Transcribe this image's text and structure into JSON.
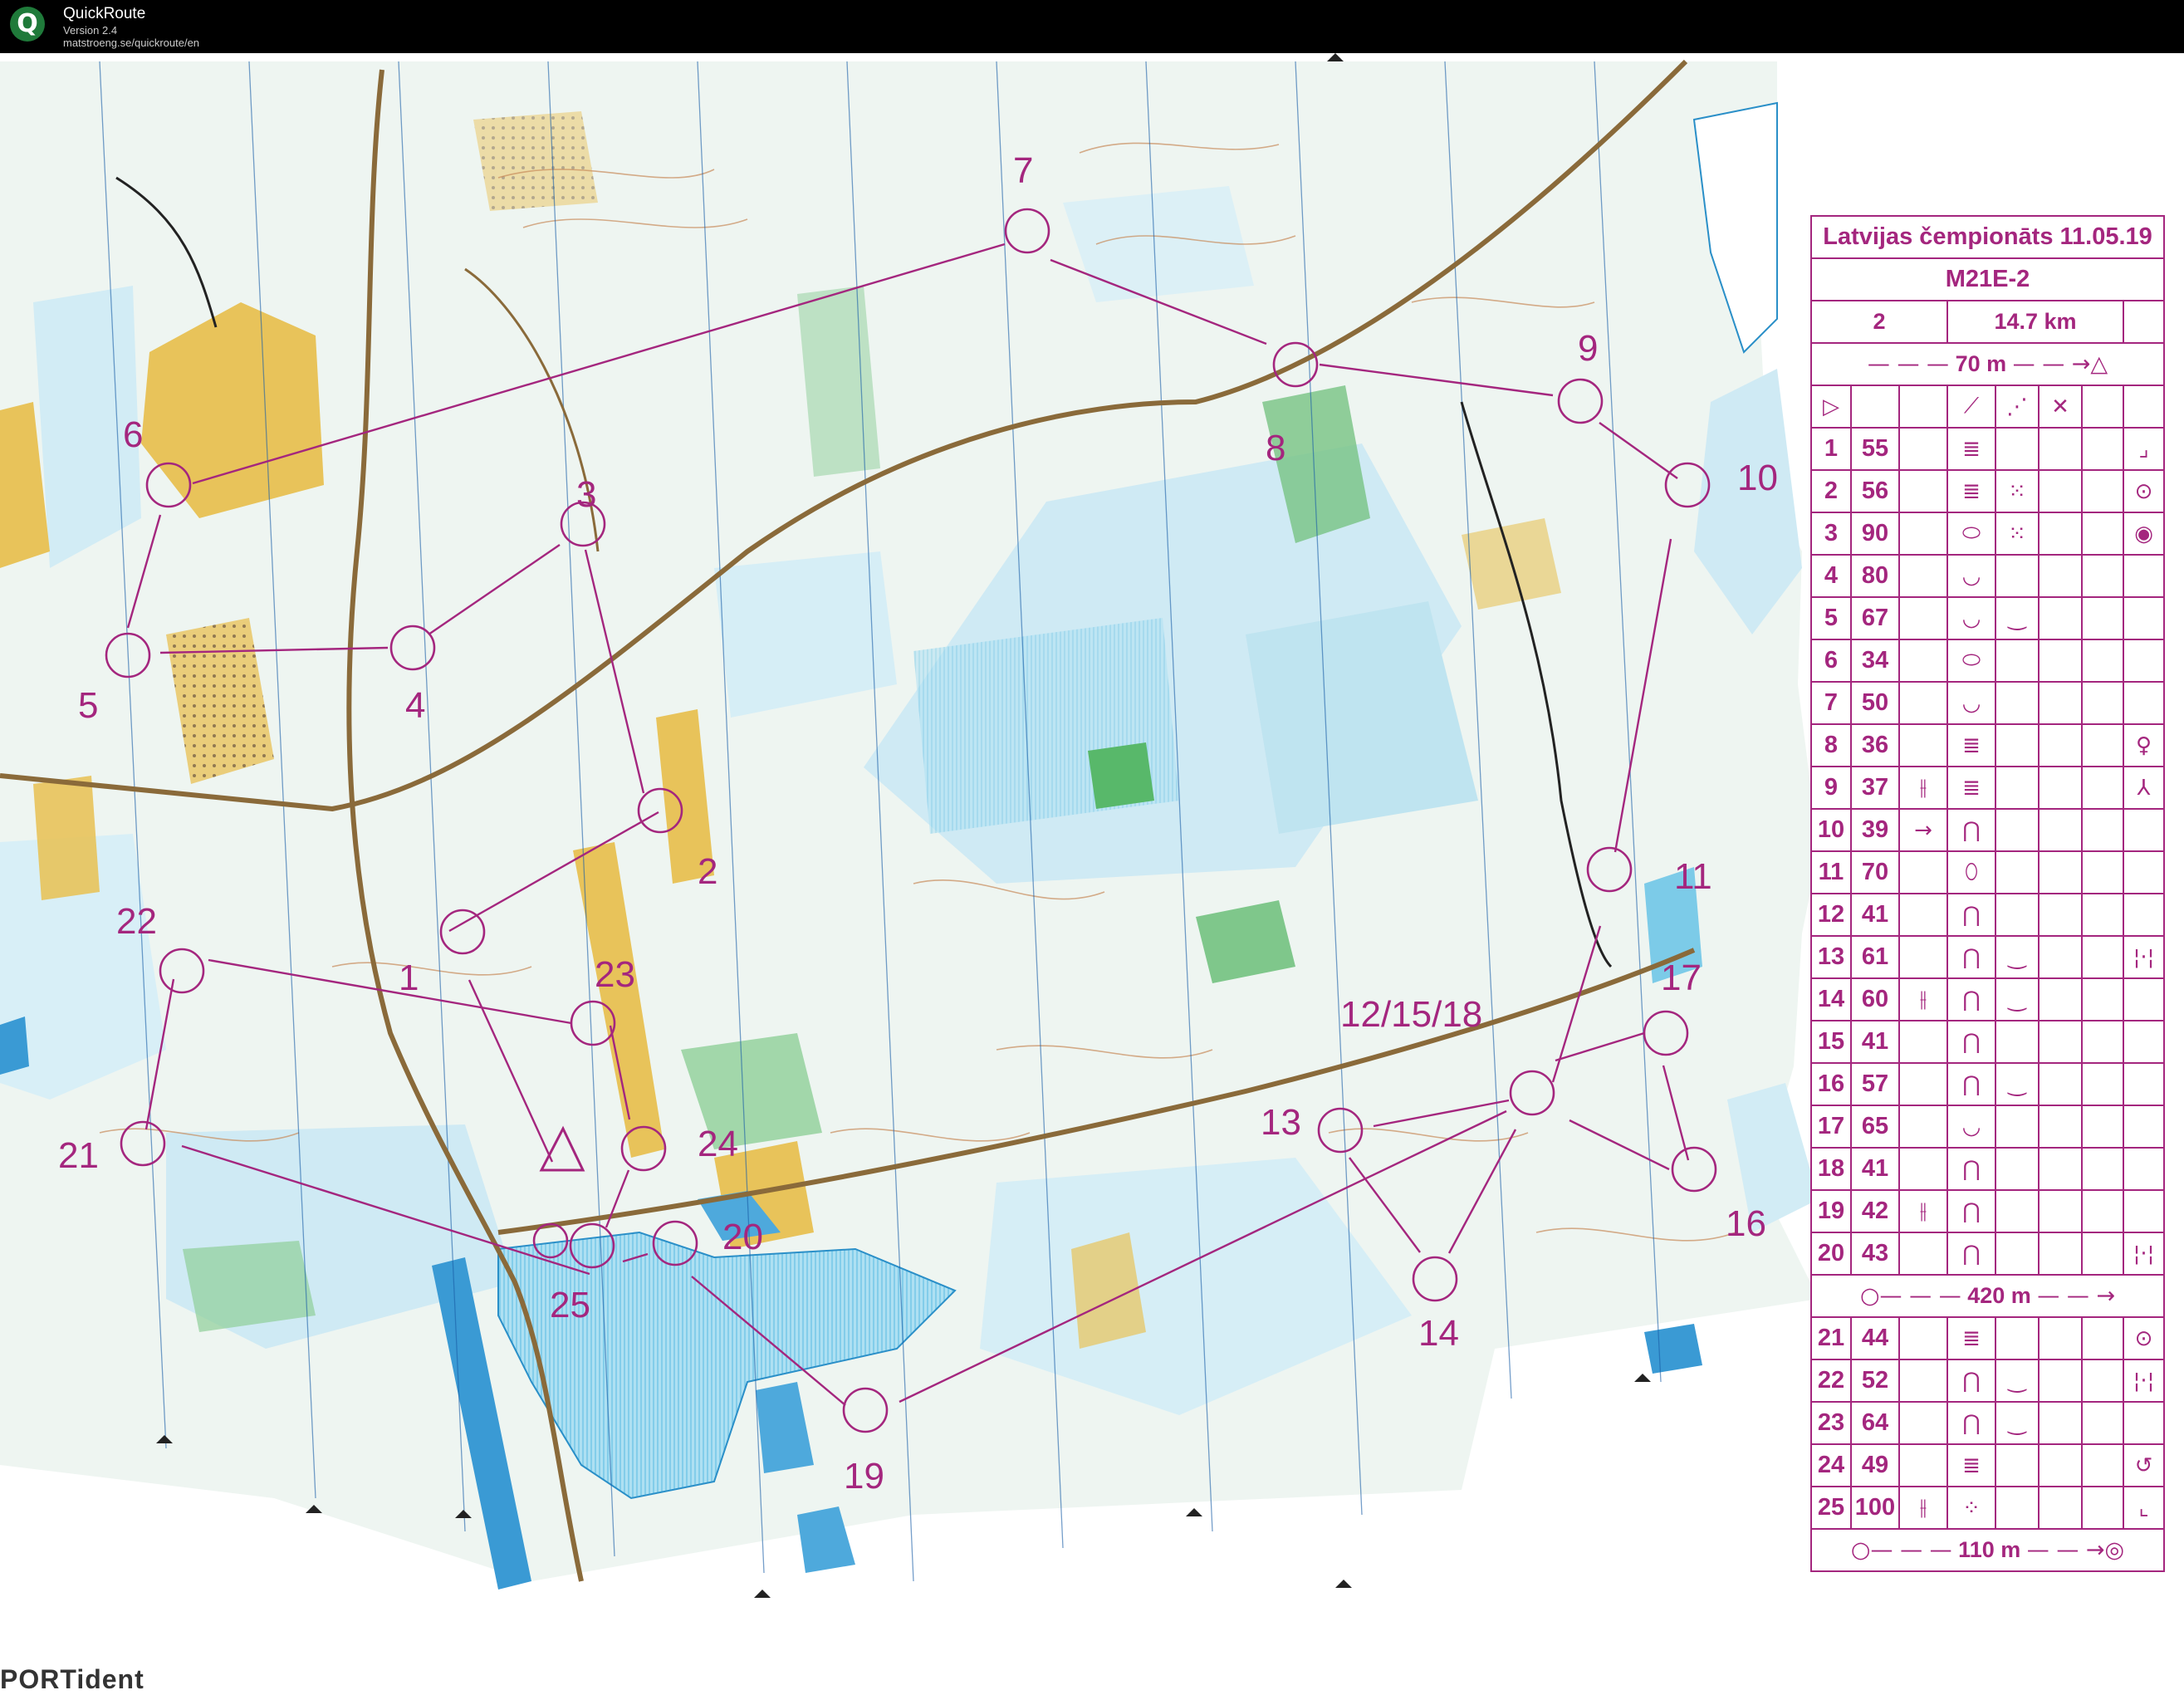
{
  "window": {
    "app_name": "QuickRoute",
    "version": "Version 2.4",
    "url": "matstroeng.se/quickroute/en",
    "icon": "quickroute-q-icon"
  },
  "map": {
    "colors": {
      "course": "#a4267e",
      "water": "#8fd1ea",
      "open_land": "#e8c35a",
      "green": "#58b86a",
      "contour": "#c88a5a",
      "road": "#8a6a3a"
    },
    "controls": [
      {
        "label": "1",
        "code": "55"
      },
      {
        "label": "2",
        "code": "56"
      },
      {
        "label": "3",
        "code": "90"
      },
      {
        "label": "4",
        "code": "80"
      },
      {
        "label": "5",
        "code": "67"
      },
      {
        "label": "6",
        "code": "34"
      },
      {
        "label": "7",
        "code": "50"
      },
      {
        "label": "8",
        "code": "36"
      },
      {
        "label": "9",
        "code": "37"
      },
      {
        "label": "10",
        "code": "39"
      },
      {
        "label": "11",
        "code": "70"
      },
      {
        "label": "12/15/18",
        "code": "41"
      },
      {
        "label": "13",
        "code": "61"
      },
      {
        "label": "14",
        "code": "60"
      },
      {
        "label": "16",
        "code": "57"
      },
      {
        "label": "17",
        "code": "65"
      },
      {
        "label": "19",
        "code": "42"
      },
      {
        "label": "20",
        "code": "43"
      },
      {
        "label": "21",
        "code": "44"
      },
      {
        "label": "22",
        "code": "52"
      },
      {
        "label": "23",
        "code": "64"
      },
      {
        "label": "24",
        "code": "49"
      },
      {
        "label": "25",
        "code": "100"
      }
    ],
    "brand_text": "PORTident"
  },
  "description_sheet": {
    "event": "Latvijas čempionāts 11.05.19",
    "class": "M21E-2",
    "course_number": "2",
    "length": "14.7 km",
    "start_tape": "70 m",
    "header_symbols": [
      "start-triangle-icon",
      "",
      "",
      "slope-line-icon",
      "dotted-band-icon",
      "cross-icon",
      "",
      ""
    ],
    "rows": [
      {
        "n": "1",
        "code": "55",
        "c": "",
        "d": "≣",
        "e": "",
        "f": "",
        "g": "",
        "h": "⌟"
      },
      {
        "n": "2",
        "code": "56",
        "c": "",
        "d": "≣",
        "e": "⁙",
        "f": "",
        "g": "",
        "h": "⊙"
      },
      {
        "n": "3",
        "code": "90",
        "c": "",
        "d": "⬭",
        "e": "⁙",
        "f": "",
        "g": "",
        "h": "◉"
      },
      {
        "n": "4",
        "code": "80",
        "c": "",
        "d": "◡",
        "e": "",
        "f": "",
        "g": "",
        "h": ""
      },
      {
        "n": "5",
        "code": "67",
        "c": "",
        "d": "◡",
        "e": "‿",
        "f": "",
        "g": "",
        "h": ""
      },
      {
        "n": "6",
        "code": "34",
        "c": "",
        "d": "⬭",
        "e": "",
        "f": "",
        "g": "",
        "h": ""
      },
      {
        "n": "7",
        "code": "50",
        "c": "",
        "d": "◡",
        "e": "",
        "f": "",
        "g": "",
        "h": ""
      },
      {
        "n": "8",
        "code": "36",
        "c": "",
        "d": "≣",
        "e": "",
        "f": "",
        "g": "",
        "h": "♀"
      },
      {
        "n": "9",
        "code": "37",
        "c": "⫲",
        "d": "≣",
        "e": "",
        "f": "",
        "g": "",
        "h": "⅄"
      },
      {
        "n": "10",
        "code": "39",
        "c": "→",
        "d": "⋂",
        "e": "",
        "f": "",
        "g": "",
        "h": ""
      },
      {
        "n": "11",
        "code": "70",
        "c": "",
        "d": "⬯",
        "e": "",
        "f": "",
        "g": "",
        "h": ""
      },
      {
        "n": "12",
        "code": "41",
        "c": "",
        "d": "⋂",
        "e": "",
        "f": "",
        "g": "",
        "h": ""
      },
      {
        "n": "13",
        "code": "61",
        "c": "",
        "d": "⋂",
        "e": "‿",
        "f": "",
        "g": "",
        "h": "¦·¦"
      },
      {
        "n": "14",
        "code": "60",
        "c": "⫲",
        "d": "⋂",
        "e": "‿",
        "f": "",
        "g": "",
        "h": ""
      },
      {
        "n": "15",
        "code": "41",
        "c": "",
        "d": "⋂",
        "e": "",
        "f": "",
        "g": "",
        "h": ""
      },
      {
        "n": "16",
        "code": "57",
        "c": "",
        "d": "⋂",
        "e": "‿",
        "f": "",
        "g": "",
        "h": ""
      },
      {
        "n": "17",
        "code": "65",
        "c": "",
        "d": "◡",
        "e": "",
        "f": "",
        "g": "",
        "h": ""
      },
      {
        "n": "18",
        "code": "41",
        "c": "",
        "d": "⋂",
        "e": "",
        "f": "",
        "g": "",
        "h": ""
      },
      {
        "n": "19",
        "code": "42",
        "c": "⫲",
        "d": "⋂",
        "e": "",
        "f": "",
        "g": "",
        "h": ""
      },
      {
        "n": "20",
        "code": "43",
        "c": "",
        "d": "⋂",
        "e": "",
        "f": "",
        "g": "",
        "h": "¦·¦"
      }
    ],
    "mid_tape": "420 m",
    "rows2": [
      {
        "n": "21",
        "code": "44",
        "c": "",
        "d": "≣",
        "e": "",
        "f": "",
        "g": "",
        "h": "⊙"
      },
      {
        "n": "22",
        "code": "52",
        "c": "",
        "d": "⋂",
        "e": "‿",
        "f": "",
        "g": "",
        "h": "¦·¦"
      },
      {
        "n": "23",
        "code": "64",
        "c": "",
        "d": "⋂",
        "e": "‿",
        "f": "",
        "g": "",
        "h": ""
      },
      {
        "n": "24",
        "code": "49",
        "c": "",
        "d": "≣",
        "e": "",
        "f": "",
        "g": "",
        "h": "↺"
      },
      {
        "n": "25",
        "code": "100",
        "c": "⫲",
        "d": "⁘",
        "e": "",
        "f": "",
        "g": "",
        "h": "⌞"
      }
    ],
    "finish_tape": "110 m"
  }
}
